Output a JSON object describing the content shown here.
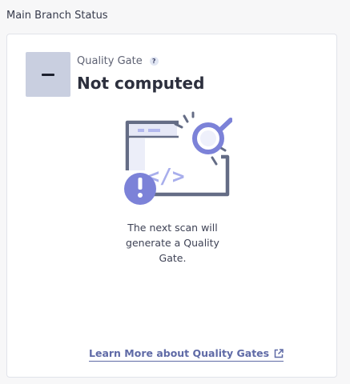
{
  "section": {
    "title": "Main Branch Status"
  },
  "quality_gate": {
    "label": "Quality Gate",
    "help_glyph": "?",
    "badge_symbol": "–",
    "status": "Not computed",
    "badge_color": "#c9cfe0"
  },
  "illustration": {
    "icon": "code-inspection-illustration",
    "accent_color": "#7c82d8",
    "frame_color": "#646c85"
  },
  "message": "The next scan will generate a Quality Gate.",
  "learn_more": {
    "label": "Learn More about Quality Gates",
    "icon": "external-link-icon",
    "color": "#5f6aa6"
  }
}
